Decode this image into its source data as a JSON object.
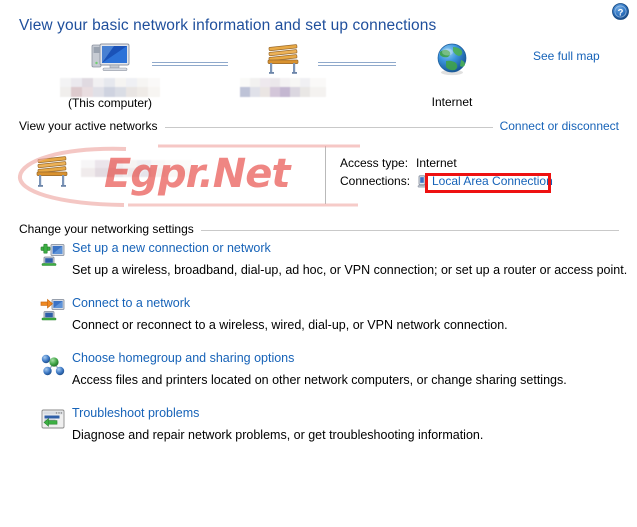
{
  "window": {
    "title": "View your basic network information and set up connections",
    "help_icon": "help-question-icon",
    "help_label": "?"
  },
  "network_map": {
    "nodes": [
      {
        "icon": "computer-monitor-icon",
        "name_redacted": true,
        "caption": "(This computer)"
      },
      {
        "icon": "network-bench-icon",
        "name_redacted": true,
        "caption": ""
      },
      {
        "icon": "internet-globe-icon",
        "name_redacted": false,
        "caption": "Internet"
      }
    ],
    "see_full_map_label": "See full map"
  },
  "active_networks": {
    "section_label": "View your active networks",
    "section_action_label": "Connect or disconnect",
    "network": {
      "icon": "network-bench-icon",
      "name_redacted": true,
      "details": [
        {
          "key": "Access type:",
          "value": "Internet",
          "is_link": false
        },
        {
          "key": "Connections:",
          "value": "Local Area Connection",
          "is_link": true,
          "icon": "network-adapter-icon"
        }
      ]
    },
    "annotation": {
      "type": "red-rectangle-highlight",
      "targets": "Local Area Connection",
      "color": "#EE1111"
    }
  },
  "watermark": {
    "text": "Egpr.Net",
    "color": "#E4342E"
  },
  "settings": {
    "section_label": "Change your networking settings",
    "tasks": [
      {
        "icon": "add-new-connection-icon",
        "link": "Set up a new connection or network",
        "description": "Set up a wireless, broadband, dial-up, ad hoc, or VPN connection; or set up a router or access point."
      },
      {
        "icon": "connect-to-network-icon",
        "link": "Connect to a network",
        "description": "Connect or reconnect to a wireless, wired, dial-up, or VPN network connection."
      },
      {
        "icon": "homegroup-sharing-icon",
        "link": "Choose homegroup and sharing options",
        "description": "Access files and printers located on other network computers, or change sharing settings."
      },
      {
        "icon": "troubleshoot-icon",
        "link": "Troubleshoot problems",
        "description": "Diagnose and repair network problems, or get troubleshooting information."
      }
    ]
  },
  "colors": {
    "link": "#1763B8",
    "title": "#1F4F9C",
    "annotation": "#EE1111",
    "rule": "#C9C9C9"
  }
}
